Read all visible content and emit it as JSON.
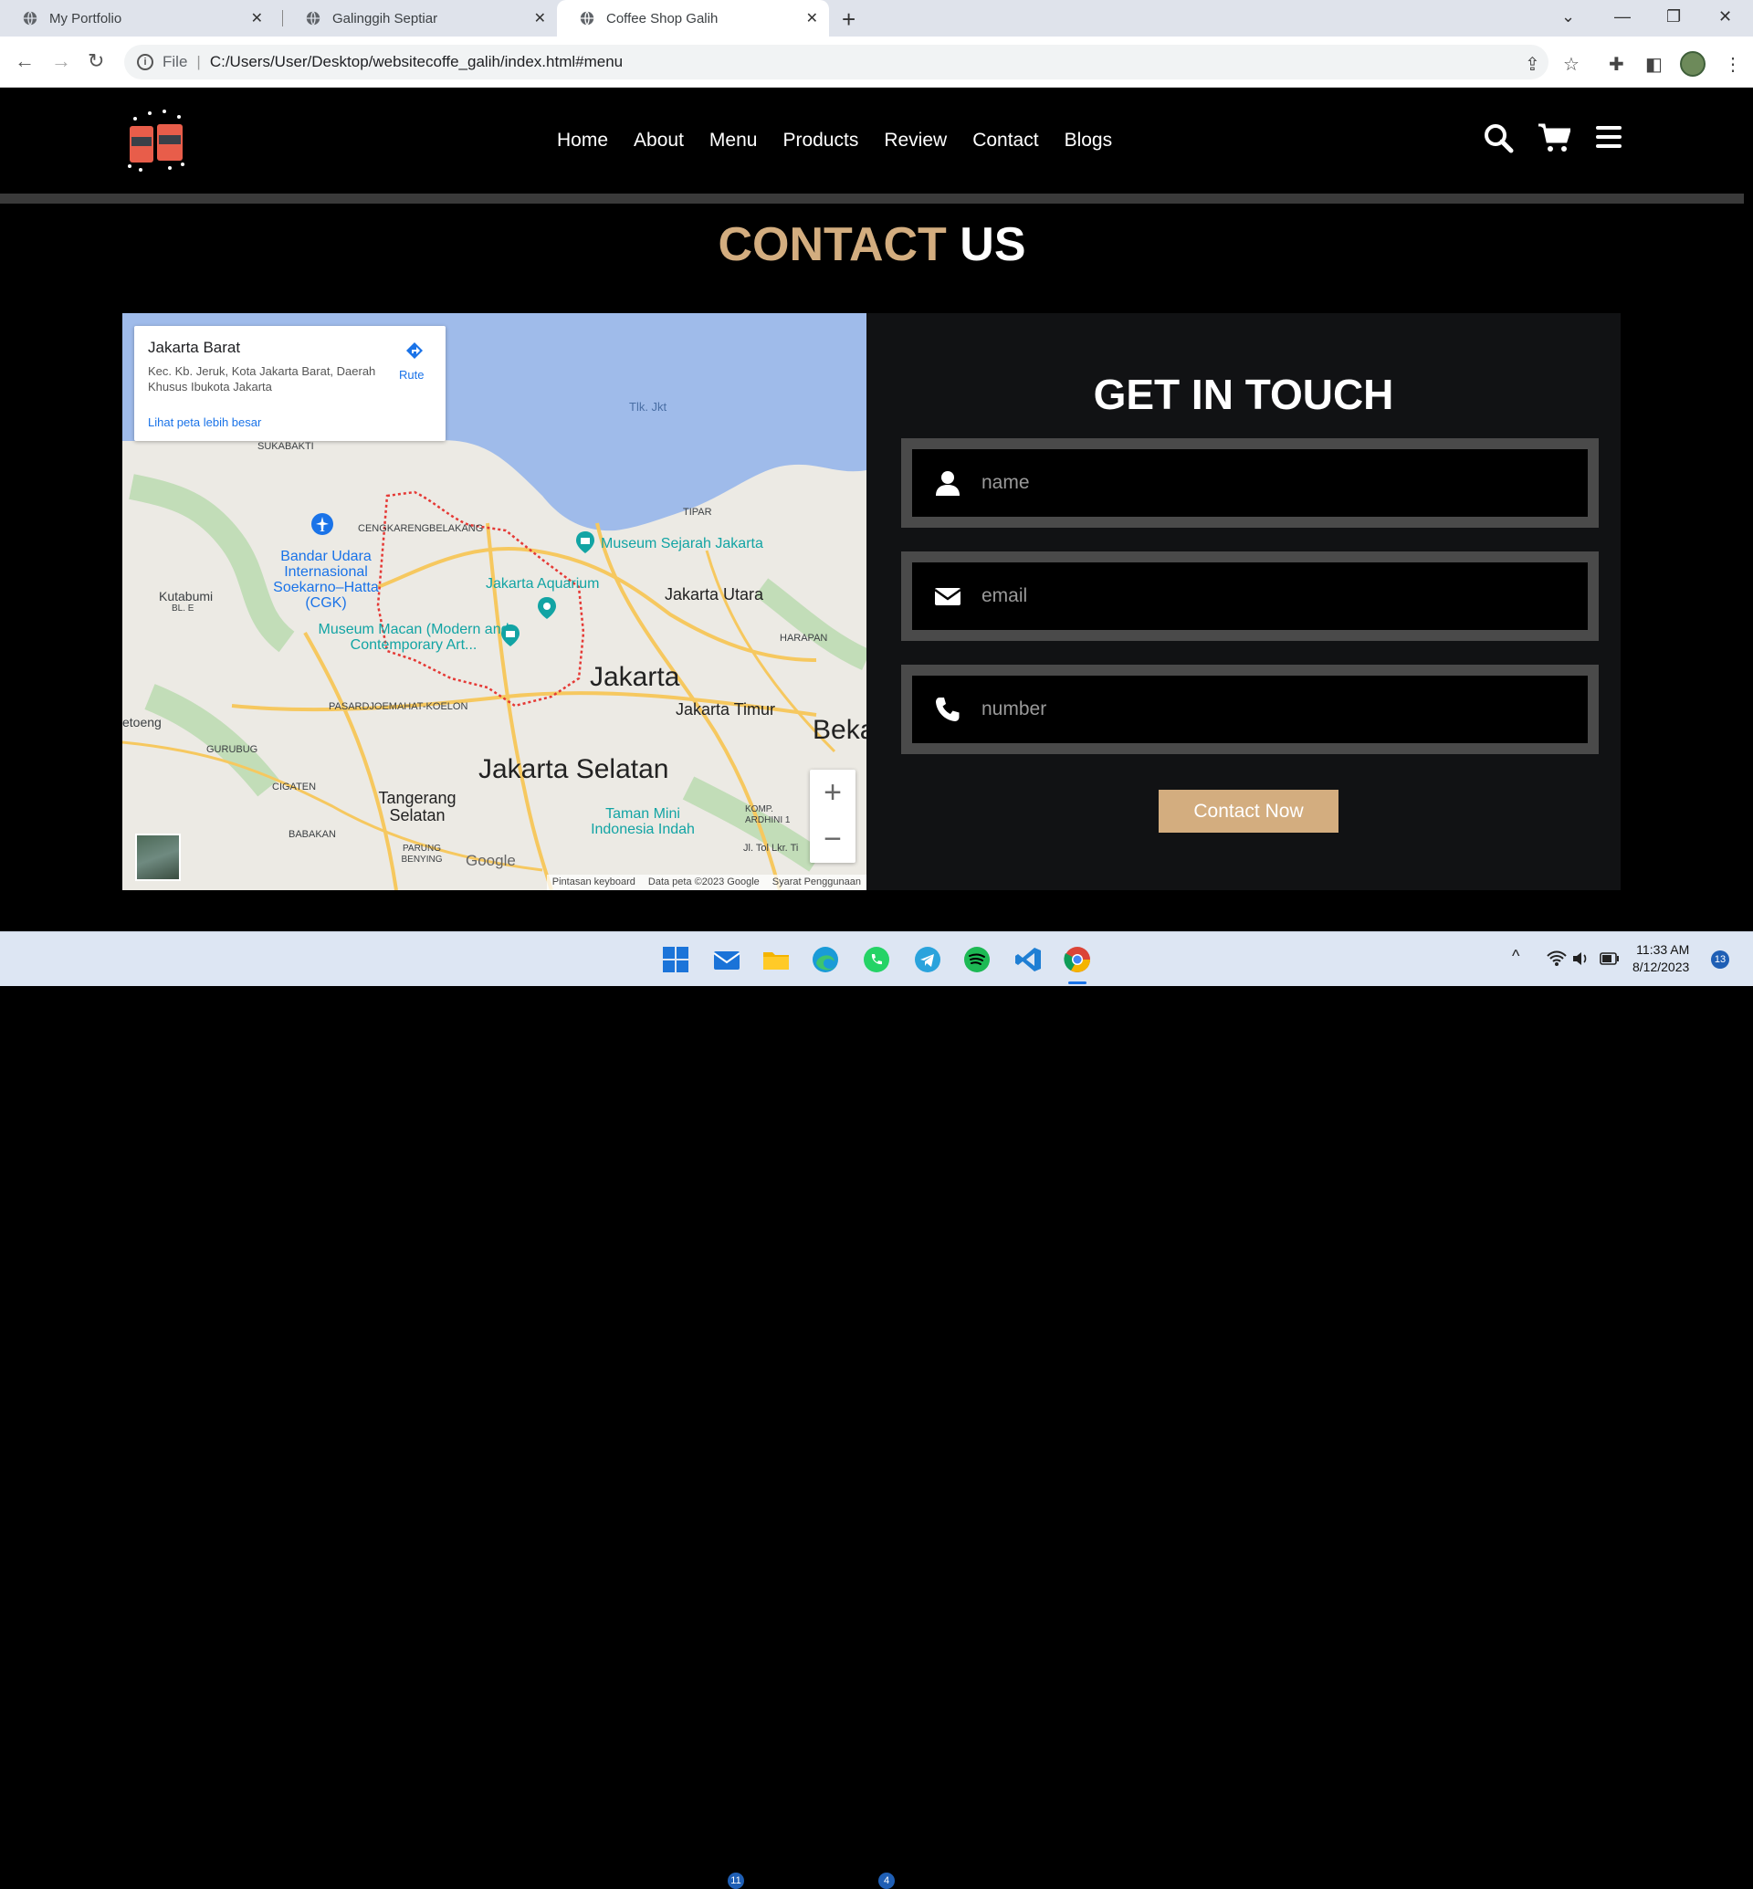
{
  "browser": {
    "tabs": [
      {
        "title": "My Portfolio"
      },
      {
        "title": "Galinggih Septiar"
      },
      {
        "title": "Coffee Shop Galih"
      }
    ],
    "address": {
      "scheme_label": "File",
      "url": "C:/Users/User/Desktop/websitecoffe_galih/index.html#menu"
    }
  },
  "header": {
    "nav": [
      "Home",
      "About",
      "Menu",
      "Products",
      "Review",
      "Contact",
      "Blogs"
    ]
  },
  "contact": {
    "heading_accent": "CONTACT",
    "heading_rest": "US",
    "form_title": "GET IN TOUCH",
    "name_placeholder": "name",
    "email_placeholder": "email",
    "number_placeholder": "number",
    "submit_label": "Contact Now"
  },
  "map": {
    "place_title": "Jakarta Barat",
    "place_address": "Kec. Kb. Jeruk, Kota Jakarta Barat, Daerah Khusus Ibukota Jakarta",
    "larger_map_link": "Lihat peta lebih besar",
    "route_label": "Rute",
    "labels": {
      "tlk": "Tlk. Jkt",
      "sukabakti": "SUKABAKTI",
      "airport": "Bandar Udara Internasional Soekarno–Hatta (CGK)",
      "cengkareng": "CENGKARENG",
      "belakang": "BELAKANG",
      "tipar": "TIPAR",
      "museum_sejarah": "Museum Sejarah Jakarta",
      "jakarta_aquarium": "Jakarta Aquarium",
      "jakarta_utara": "Jakarta Utara",
      "kutabumi": "Kutabumi",
      "bl_e": "BL. E",
      "museum_macan": "Museum Macan (Modern and Contemporary Art...",
      "harapan": "HARAPAN",
      "jakarta": "Jakarta",
      "jakarta_timur": "Jakarta Timur",
      "pasar": "PASARDJOEMAHAT-KOELON",
      "betoeng": "etoeng",
      "bekasi": "Beka",
      "gurubug": "GURUBUG",
      "jakarta_selatan": "Jakarta Selatan",
      "cigaten": "CIGATEN",
      "tangerang_selatan": "Tangerang Selatan",
      "taman_mini": "Taman Mini Indonesia Indah",
      "komp": "KOMP. ARDHINI 1",
      "babakan": "BABAKAN",
      "parung": "PARUNG BENYING",
      "jl_tol": "Jl. Tol Lkr. Ti",
      "google": "Google"
    },
    "footer": [
      "Pintasan keyboard",
      "Data peta ©2023 Google",
      "Syarat Penggunaan"
    ]
  },
  "taskbar": {
    "mail_badge": "11",
    "whatsapp_badge": "4",
    "time": "11:33 AM",
    "date": "8/12/2023",
    "notification_count": "13"
  },
  "colors": {
    "accent": "#d3ad7f",
    "panel": "#111214",
    "field_border": "#4a4a4a"
  }
}
